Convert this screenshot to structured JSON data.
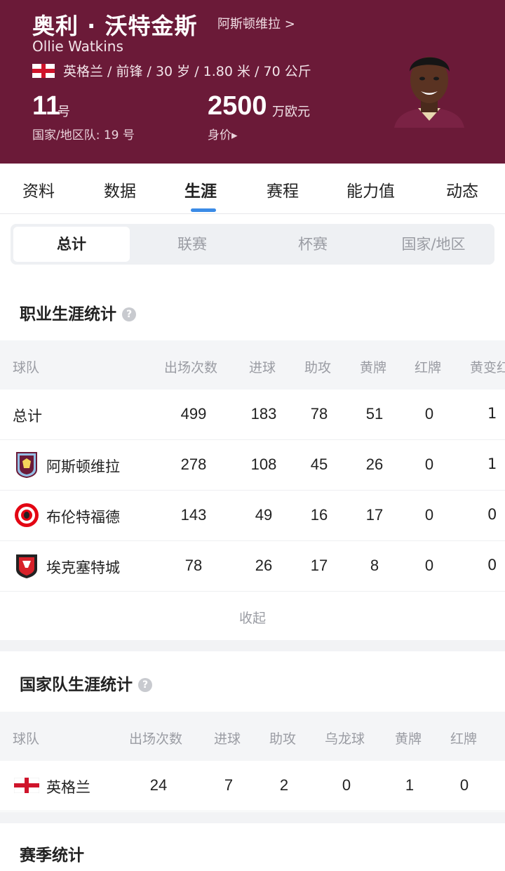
{
  "player": {
    "name_cn": "奥利 · 沃特金斯",
    "club_link": "阿斯顿维拉 >",
    "name_en": "Ollie Watkins",
    "nationality": "英格兰",
    "info": "英格兰 / 前锋 / 30 岁 / 1.80 米 / 70 公斤",
    "shirt_number": "11",
    "shirt_unit": "号",
    "national_team": "国家/地区队: 19 号",
    "market_value": "2500",
    "market_value_unit": "万欧元",
    "market_value_label": "身价▸"
  },
  "tabs": [
    "资料",
    "数据",
    "生涯",
    "赛程",
    "能力值",
    "动态"
  ],
  "active_tab": "生涯",
  "segments": [
    "总计",
    "联赛",
    "杯赛",
    "国家/地区"
  ],
  "career": {
    "title": "职业生涯统计",
    "columns": [
      "球队",
      "出场次数",
      "进球",
      "助攻",
      "黄牌",
      "红牌",
      "黄变红"
    ],
    "rows": [
      {
        "team": "总计",
        "apps": "499",
        "goals": "183",
        "assists": "78",
        "yellow": "51",
        "red": "0",
        "second_yellow": "1"
      },
      {
        "team": "阿斯顿维拉",
        "apps": "278",
        "goals": "108",
        "assists": "45",
        "yellow": "26",
        "red": "0",
        "second_yellow": "1"
      },
      {
        "team": "布伦特福德",
        "apps": "143",
        "goals": "49",
        "assists": "16",
        "yellow": "17",
        "red": "0",
        "second_yellow": "0"
      },
      {
        "team": "埃克塞特城",
        "apps": "78",
        "goals": "26",
        "assists": "17",
        "yellow": "8",
        "red": "0",
        "second_yellow": "0"
      }
    ],
    "collapse": "收起"
  },
  "national": {
    "title": "国家队生涯统计",
    "columns": [
      "球队",
      "出场次数",
      "进球",
      "助攻",
      "乌龙球",
      "黄牌",
      "红牌"
    ],
    "rows": [
      {
        "team": "英格兰",
        "apps": "24",
        "goals": "7",
        "assists": "2",
        "own_goals": "0",
        "yellow": "1",
        "red": "0"
      }
    ]
  },
  "season": {
    "title": "赛季统计"
  },
  "colors": {
    "header_bg": "#6b1a38",
    "tab_indicator": "#3b8be6"
  }
}
